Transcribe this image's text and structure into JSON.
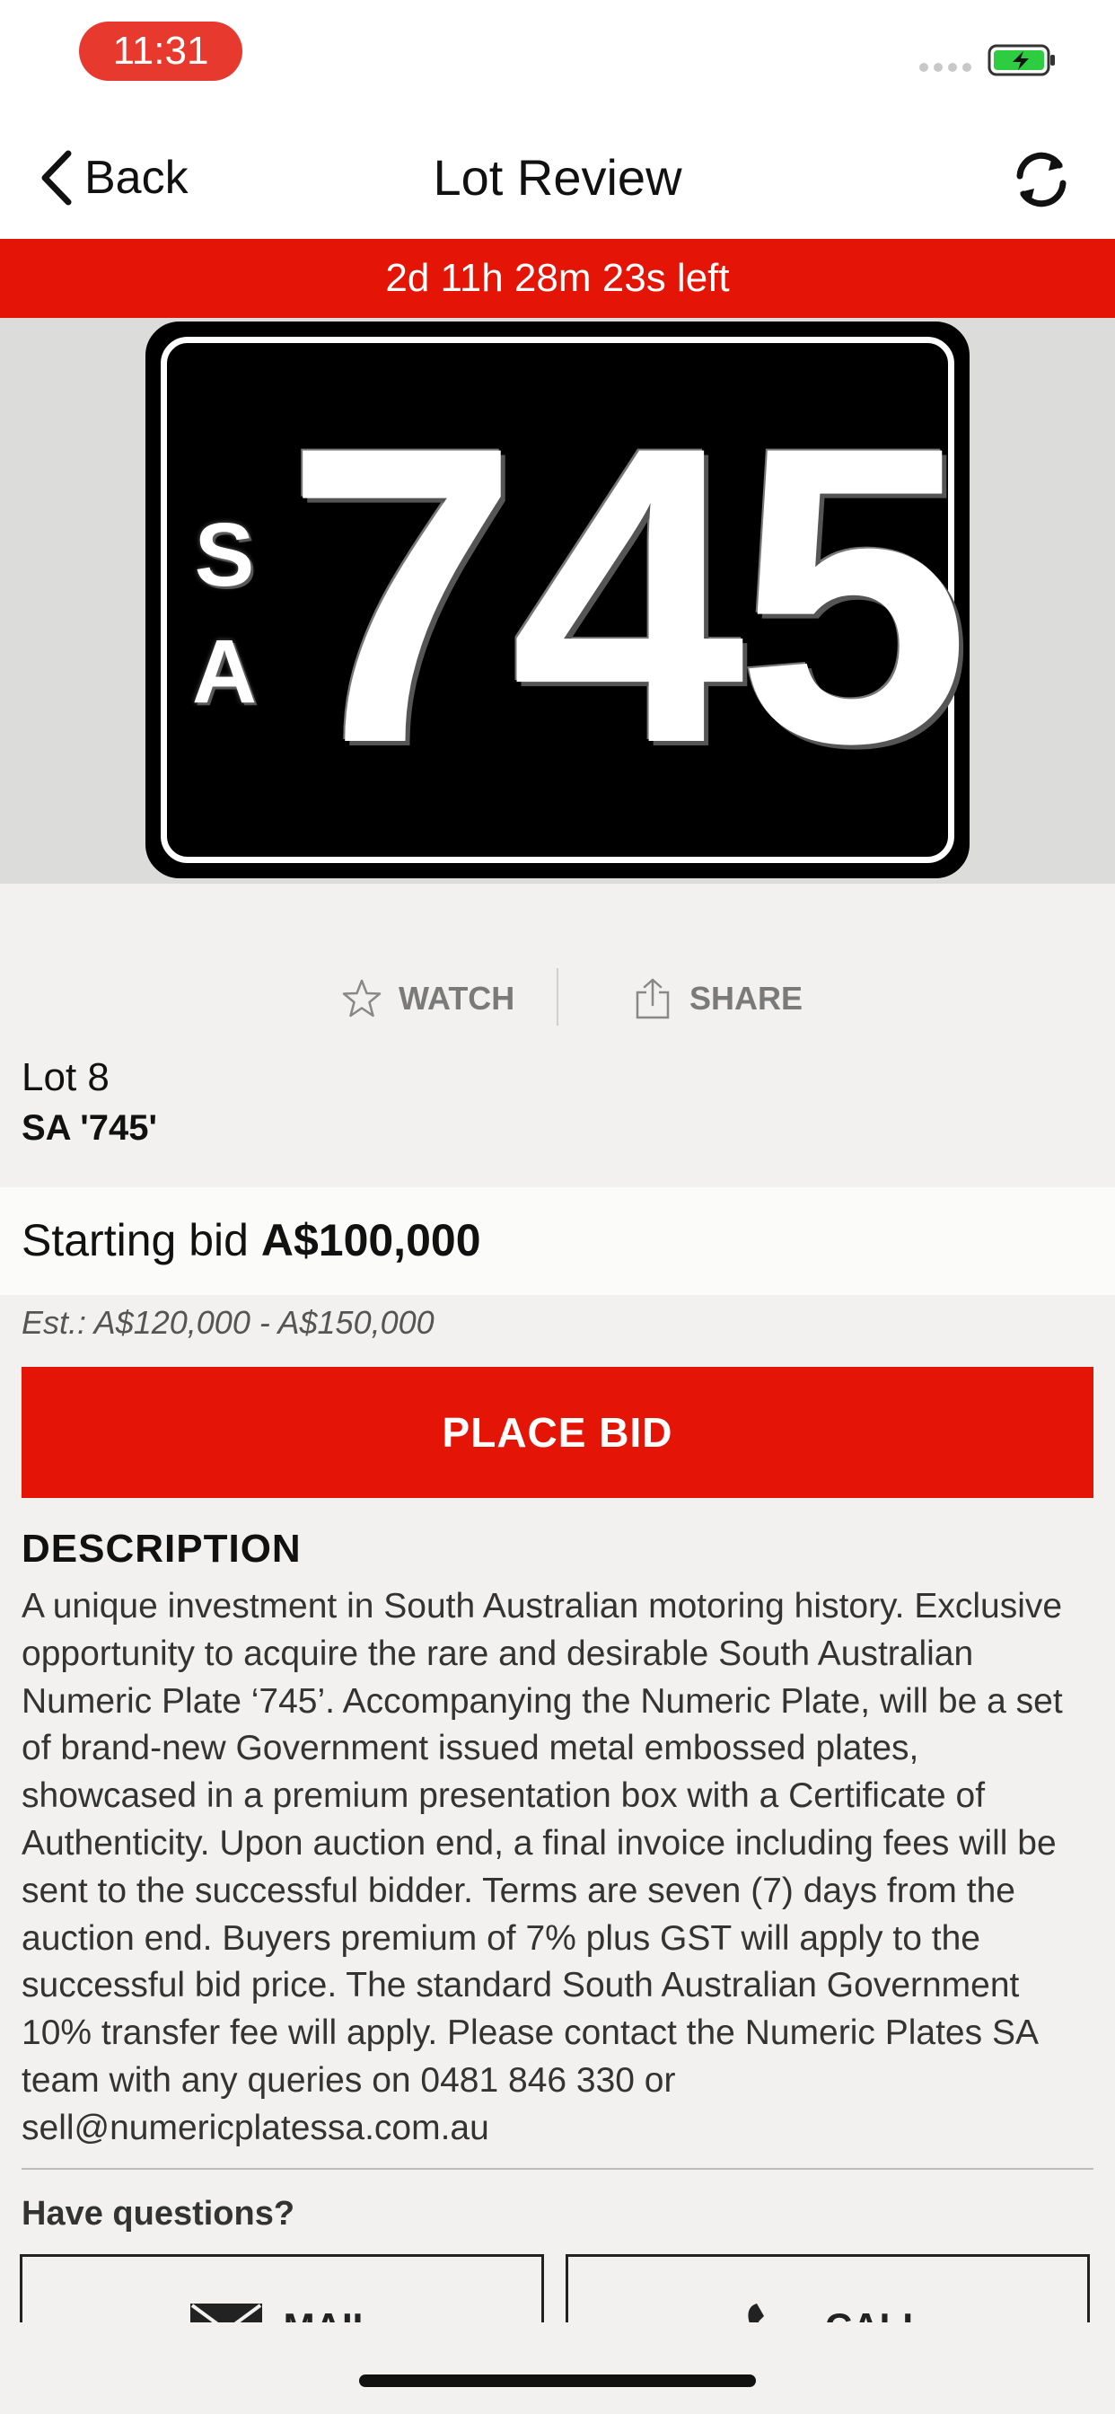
{
  "status_bar": {
    "time": "11:31"
  },
  "nav": {
    "back_label": "Back",
    "title": "Lot Review"
  },
  "timer": {
    "text": "2d 11h 28m 23s left"
  },
  "plate": {
    "state": [
      "S",
      "A"
    ],
    "number": "745"
  },
  "actions": {
    "watch_label": "WATCH",
    "share_label": "SHARE"
  },
  "lot": {
    "number": "Lot 8",
    "plate_name": "SA '745'"
  },
  "bid": {
    "starting_label": "Starting bid",
    "starting_amount": "A$100,000",
    "estimate": "Est.: A$120,000 - A$150,000",
    "place_bid_label": "PLACE BID"
  },
  "description": {
    "heading": "DESCRIPTION",
    "body": "A unique investment in South Australian motoring history. Exclusive opportunity to acquire the rare and desirable South Australian Numeric Plate ‘745’. Accompanying the Numeric Plate, will be a set of brand-new Government issued metal embossed plates, showcased in a premium presentation box with a Certificate of Authenticity. Upon auction end, a final invoice including fees will be sent to the successful bidder. Terms are seven (7) days from the auction end. Buyers premium of 7% plus GST will apply to the successful bid price. The standard South Australian Government 10% transfer fee will apply. Please contact the Numeric Plates SA team with any queries on 0481 846 330 or sell@numericplatessa.com.au"
  },
  "contact": {
    "heading": "Have questions?",
    "mail_label": "MAIL",
    "call_label": "CALL"
  },
  "colors": {
    "accent": "#e41506",
    "time_pill": "#e8392f",
    "battery": "#2ecc40"
  },
  "icons": [
    "back-chevron-icon",
    "refresh-icon",
    "star-icon",
    "share-icon",
    "mail-icon",
    "phone-icon",
    "battery-icon"
  ]
}
